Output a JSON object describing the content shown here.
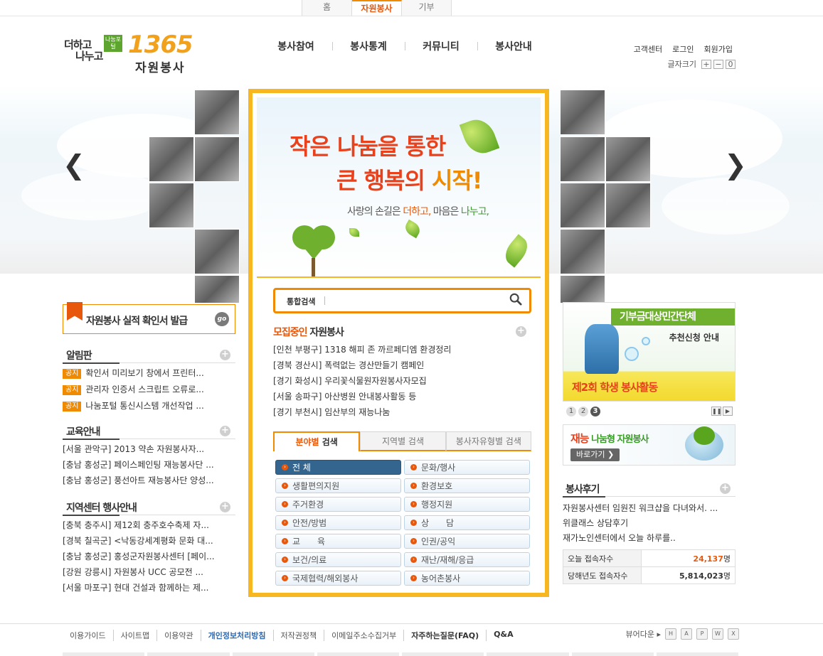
{
  "top_tabs": [
    {
      "label": "홈",
      "active": false
    },
    {
      "label": "자원봉사",
      "active": true
    },
    {
      "label": "기부",
      "active": false
    }
  ],
  "logo": {
    "line1": "더하고",
    "line2": "나누고",
    "badge": "나눔포털",
    "number": "1365",
    "sub": "자원봉사"
  },
  "gnb": [
    "봉사참여",
    "봉사통계",
    "커뮤니티",
    "봉사안내"
  ],
  "util": [
    "고객센터",
    "로그인",
    "회원가입"
  ],
  "font_size": {
    "label": "글자크기",
    "plus": "+",
    "minus": "−",
    "reset": "0"
  },
  "hero": {
    "line1_a": "작은",
    "line1_b": " 나눔을 통한",
    "line2_a": "큰 행복의 ",
    "line2_b": "시작!",
    "tag_a": "사랑의 손길은 ",
    "tag_b": "더하고,",
    "tag_c": " 마음은 ",
    "tag_d": "나누고,"
  },
  "search": {
    "label": "통합검색",
    "placeholder": ""
  },
  "recruit": {
    "title_hl": "모집중인",
    "title": " 자원봉사",
    "items": [
      "[인천 부평구] 1318 해피 존 까르페디엠 환경정리",
      "[경북 경산시] 폭력없는 경산만들기 캠페인",
      "[경기 화성시] 우리꽃식물원자원봉사자모집",
      "[서울 송파구] 아산병원 안내봉사활동 등",
      "[경기 부천시] 임산부의 재능나눔"
    ]
  },
  "search_tabs": [
    {
      "hl": "분야별",
      "label": " 검색",
      "active": true
    },
    {
      "hl": "",
      "label": "지역별 검색",
      "active": false
    },
    {
      "hl": "",
      "label": "봉사자유형별 검색",
      "active": false
    }
  ],
  "categories": [
    {
      "label": "전 체",
      "active": true
    },
    {
      "label": "문화/행사",
      "active": false
    },
    {
      "label": "생활편의지원",
      "active": false
    },
    {
      "label": "환경보호",
      "active": false
    },
    {
      "label": "주거환경",
      "active": false
    },
    {
      "label": "행정지원",
      "active": false
    },
    {
      "label": "안전/방범",
      "active": false
    },
    {
      "label": "상　　담",
      "active": false
    },
    {
      "label": "교　　육",
      "active": false
    },
    {
      "label": "인권/공익",
      "active": false
    },
    {
      "label": "보건/의료",
      "active": false
    },
    {
      "label": "재난/재해/응급",
      "active": false
    },
    {
      "label": "국제협력/해외봉사",
      "active": false
    },
    {
      "label": "농어촌봉사",
      "active": false
    }
  ],
  "cert": {
    "text": "자원봉사 실적 확인서 발급",
    "go": "go"
  },
  "board": {
    "title": "알림판",
    "badge": "공지",
    "items": [
      "확인서 미리보기 창에서 프린터...",
      "관리자 인증서 스크립트 오류로...",
      "나눔포털 통신시스템 개선작업 ..."
    ]
  },
  "edu": {
    "title": "교육안내",
    "items": [
      "[서울 관악구] 2013 약손 자원봉사자...",
      "[충남 홍성군] 페이스페인팅 재능봉사단 ...",
      "[충남 홍성군] 풍선아트 재능봉사단 양성..."
    ]
  },
  "center": {
    "title": "지역센터 행사안내",
    "items": [
      "[충북 충주시] 제12회 충주호수축제 자...",
      "[경북 칠곡군] <낙동강세계평화 문화 대...",
      "[충남 홍성군] 홍성군자원봉사센터 [페이...",
      "[강원 강릉시] 자원봉사 UCC 공모전 ...",
      "[서울 마포구] 현대 건설과 함께하는 제..."
    ]
  },
  "right_banner": {
    "header": "기부금대상민간단체",
    "sub": "추천신청 안내",
    "event": "제2회 학생 봉사활동"
  },
  "pager": {
    "pages": [
      "1",
      "2",
      "3"
    ],
    "active": "3",
    "pause": "❚❚",
    "next": "▶"
  },
  "jaeneung": {
    "title_a": "재능",
    "title_b": " 나눔형 자원봉사",
    "button": "바로가기 ❯"
  },
  "review": {
    "title": "봉사후기",
    "items": [
      "자원봉사센터 임원진 워크샵을 다녀와서. ...",
      "위클래스 상담후기",
      "재가노인센터에서 오늘 하루를.."
    ]
  },
  "stats": [
    {
      "label": "오늘 접속자수",
      "value": "24,137",
      "unit": "명"
    },
    {
      "label": "당해년도 접속자수",
      "value": "5,814,023",
      "unit": "명"
    }
  ],
  "footer": [
    {
      "label": "이용가이드",
      "style": ""
    },
    {
      "label": "사이트맵",
      "style": ""
    },
    {
      "label": "이용약관",
      "style": ""
    },
    {
      "label": "개인정보처리방침",
      "style": "bl"
    },
    {
      "label": "저작권정책",
      "style": ""
    },
    {
      "label": "이메일주소수집거부",
      "style": ""
    },
    {
      "label": "자주하는질문(FAQ)",
      "style": "b"
    },
    {
      "label": "Q&A",
      "style": "b"
    }
  ],
  "viewer": {
    "label": "뷰어다운 ▸",
    "icons": [
      "hwp-viewer-icon",
      "pdf-viewer-icon",
      "ppt-viewer-icon",
      "word-viewer-icon",
      "excel-viewer-icon"
    ],
    "glyphs": [
      "H",
      "A",
      "P",
      "W",
      "X"
    ]
  },
  "colors": {
    "accent": "#f08a00",
    "primary_red": "#e8411c",
    "green": "#6fb02e",
    "panel_border": "#f7b720",
    "selected_cat": "#33658f"
  }
}
